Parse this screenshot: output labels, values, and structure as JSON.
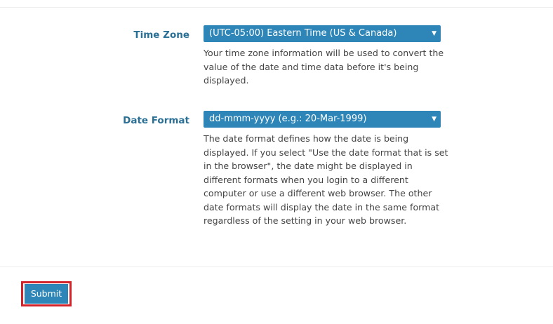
{
  "settings": {
    "time_zone": {
      "label": "Time Zone",
      "selected": "(UTC-05:00) Eastern Time (US & Canada)",
      "help": "Your time zone information will be used to convert the value of the date and time data before it's being displayed."
    },
    "date_format": {
      "label": "Date Format",
      "selected": "dd-mmm-yyyy (e.g.: 20-Mar-1999)",
      "help": "The date format defines how the date is being displayed. If you select \"Use the date format that is set in the browser\", the date might be displayed in different formats when you login to a different computer or use a different web browser. The other date formats will display the date in the same format regardless of the setting in your web browser."
    }
  },
  "actions": {
    "submit_label": "Submit"
  },
  "icons": {
    "dropdown": "chevron-down-icon"
  },
  "colors": {
    "accent": "#2e86b8",
    "label": "#2a6f95",
    "highlight_border": "#d2232a"
  }
}
